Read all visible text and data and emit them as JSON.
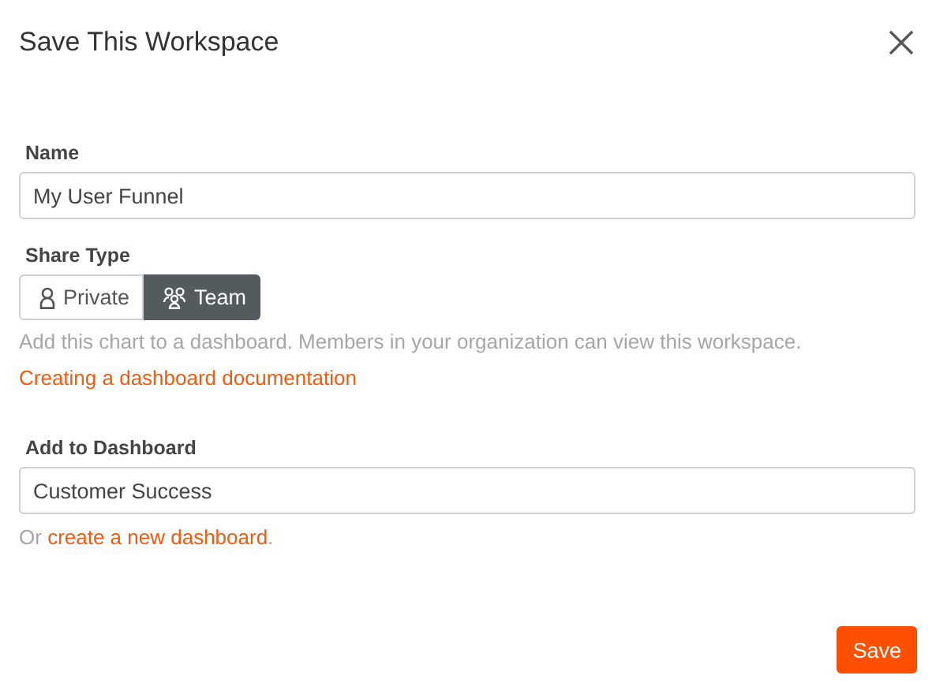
{
  "dialog": {
    "title": "Save This Workspace"
  },
  "name_field": {
    "label": "Name",
    "value": "My User Funnel"
  },
  "share_type": {
    "label": "Share Type",
    "options": [
      {
        "label": "Private",
        "kind": "person",
        "selected": false
      },
      {
        "label": "Team",
        "kind": "group",
        "selected": true
      }
    ],
    "help": "Add this chart to a dashboard. Members in your organization can view this workspace.",
    "doc_link": "Creating a dashboard documentation"
  },
  "dashboard_field": {
    "label": "Add to Dashboard",
    "value": "Customer Success",
    "hint_prefix": "Or ",
    "hint_link": "create a new dashboard",
    "hint_suffix": "."
  },
  "buttons": [
    {
      "label": "Save"
    }
  ]
}
